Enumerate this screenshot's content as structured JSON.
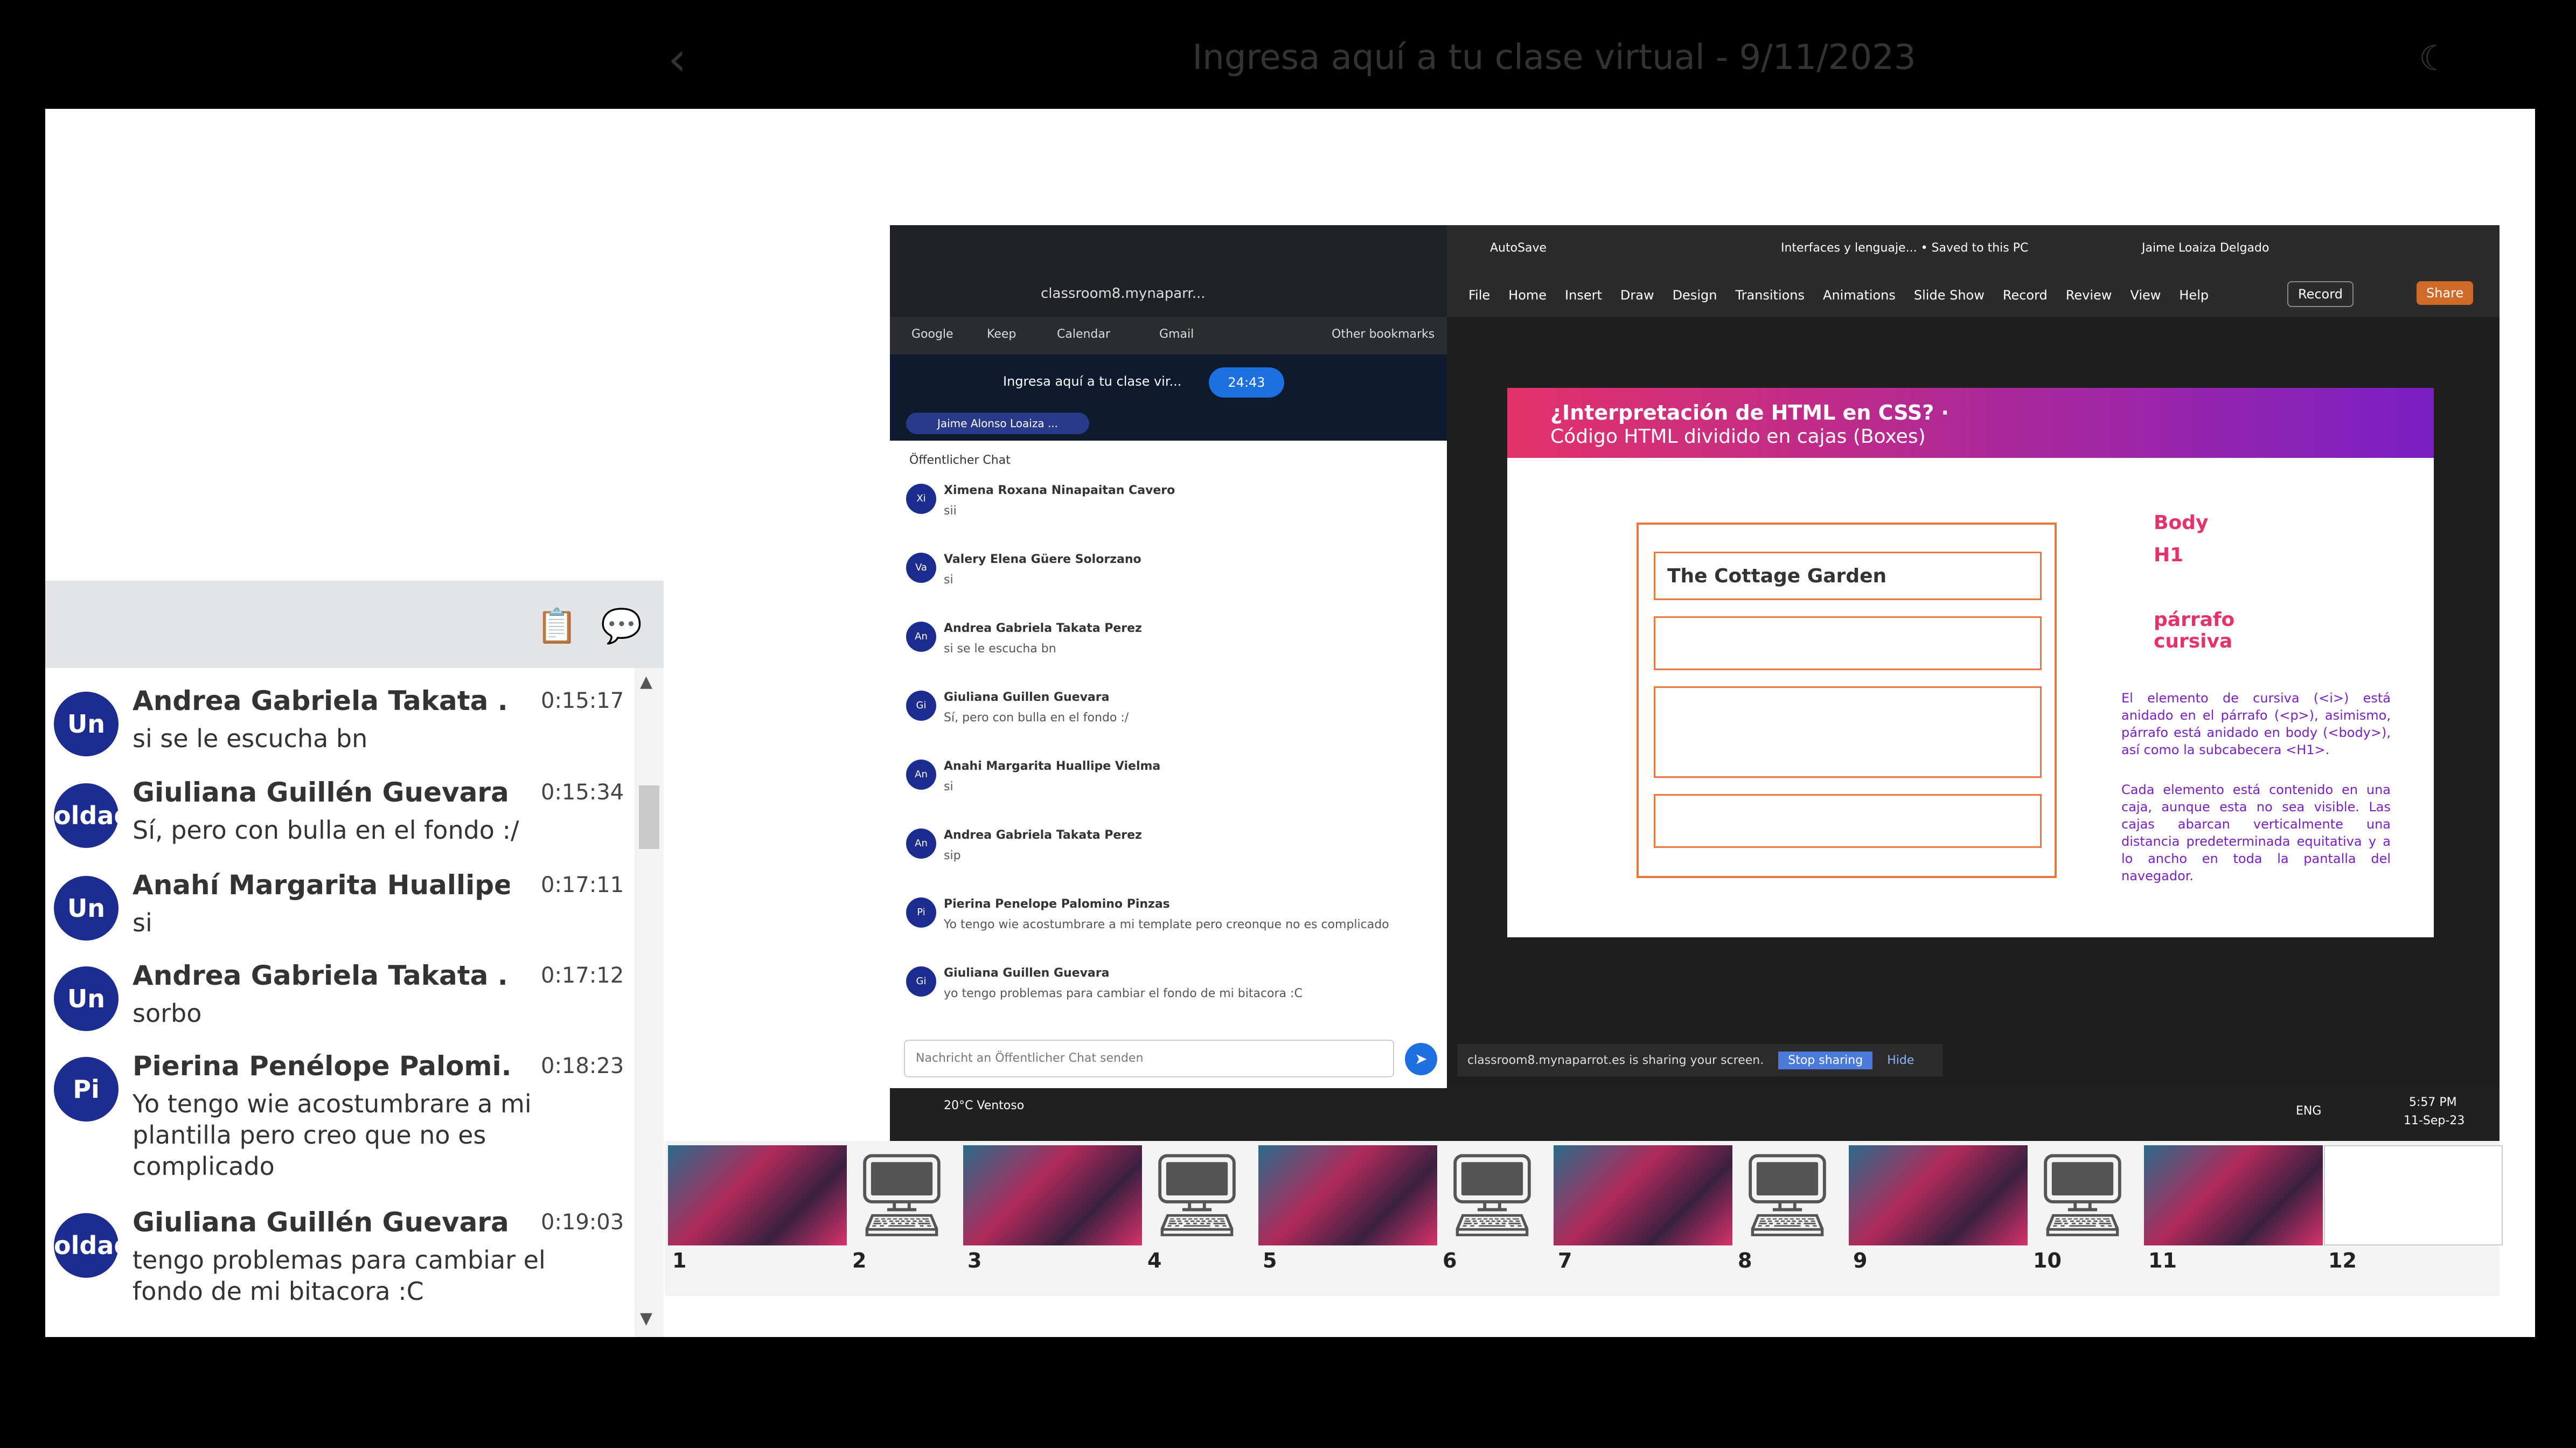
{
  "header": {
    "back_label": "‹",
    "title": "Ingresa aquí a tu clase virtual - 9/11/2023",
    "theme_label": "☾"
  },
  "chat": {
    "toolbar": {
      "copy_icon": "clipboard-icon",
      "chat_icon": "chat-bubbles-icon"
    },
    "messages": [
      {
        "avatar": "Un",
        "name": "Andrea Gabriela Takata ...",
        "time": "0:15:17",
        "text": "si se le escucha bn"
      },
      {
        "avatar": "oldaderica",
        "name": "Giuliana Guillén Guevara",
        "time": "0:15:34",
        "text": "Sí, pero con bulla en el fondo :/"
      },
      {
        "avatar": "Un",
        "name": "Anahí Margarita Huallipe...",
        "time": "0:17:11",
        "text": "si"
      },
      {
        "avatar": "Un",
        "name": "Andrea Gabriela Takata ...",
        "time": "0:17:12",
        "text": "sorbo"
      },
      {
        "avatar": "Pi",
        "name": "Pierina Penélope Palomi...",
        "time": "0:18:23",
        "text": "Yo tengo wie acostumbrare a mi plantilla pero creo que no es complicado"
      },
      {
        "avatar": "oldaderica",
        "name": "Giuliana Guillén Guevara",
        "time": "0:19:03",
        "text": "tengo problemas para cambiar el fondo de mi bitacora :C"
      }
    ]
  },
  "share": {
    "browser": {
      "url": "classroom8.mynaparr...",
      "bookmarks": [
        "Google",
        "Keep",
        "Calendar",
        "Gmail",
        "Other bookmarks"
      ],
      "meeting_title": "Ingresa aquí a tu clase vir...",
      "timer": "24:43",
      "presenter": "Jaime Alonso Loaiza ...",
      "chat_title": "Öffentlicher Chat",
      "input_placeholder": "Nachricht an Öffentlicher Chat senden",
      "messages": [
        {
          "a": "Xi",
          "n": "Ximena Roxana Ninapaitan Cavero",
          "t": "sii"
        },
        {
          "a": "Va",
          "n": "Valery Elena Güere Solorzano",
          "t": "si"
        },
        {
          "a": "An",
          "n": "Andrea Gabriela Takata Perez",
          "t": "si se le escucha bn"
        },
        {
          "a": "Gi",
          "n": "Giuliana Guillen Guevara",
          "t": "Sí, pero con bulla en el fondo :/"
        },
        {
          "a": "An",
          "n": "Anahi Margarita Huallipe Vielma",
          "t": "si"
        },
        {
          "a": "An",
          "n": "Andrea Gabriela Takata Perez",
          "t": "sip"
        },
        {
          "a": "Pi",
          "n": "Pierina Penelope Palomino Pinzas",
          "t": "Yo tengo wie acostumbrare a mi template pero creonque no es complicado"
        },
        {
          "a": "Gi",
          "n": "Giuliana Guillen Guevara",
          "t": "yo tengo problemas para cambiar el fondo de mi bitacora :C"
        }
      ],
      "weather": "20°C Ventoso"
    },
    "ppt": {
      "autosave": "AutoSave",
      "file_title": "Interfaces y lenguaje... • Saved to this PC",
      "user": "Jaime Loaiza Delgado",
      "menu": [
        "File",
        "Home",
        "Insert",
        "Draw",
        "Design",
        "Transitions",
        "Animations",
        "Slide Show",
        "Record",
        "Review",
        "View",
        "Help"
      ],
      "record": "Record",
      "share": "Share",
      "slide": {
        "title": "¿Interpretación de HTML en CSS? ·",
        "subtitle": "Código HTML dividido en cajas (Boxes)",
        "box_title": "The Cottage Garden",
        "labels": [
          "Body",
          "H1",
          "párrafo",
          "cursiva"
        ],
        "para1": "El elemento de cursiva (<i>) está anidado en el párrafo (<p>), asimismo, párrafo está anidado en body (<body>), así como la subcabecera <H1>.",
        "para2": "Cada elemento está contenido en una caja, aunque esta no sea visible. Las cajas abarcan verticalmente una distancia predeterminada equitativa y a lo ancho en toda la pantalla del navegador."
      },
      "sharing": "classroom8.mynaparrot.es is sharing your screen.",
      "stop": "Stop sharing",
      "hide": "Hide"
    },
    "clock": "5:57 PM",
    "date": "11-Sep-23",
    "lang": "ENG"
  },
  "thumbs": [
    "1",
    "2",
    "3",
    "4",
    "5",
    "6",
    "7",
    "8",
    "9",
    "10",
    "11",
    "12"
  ]
}
